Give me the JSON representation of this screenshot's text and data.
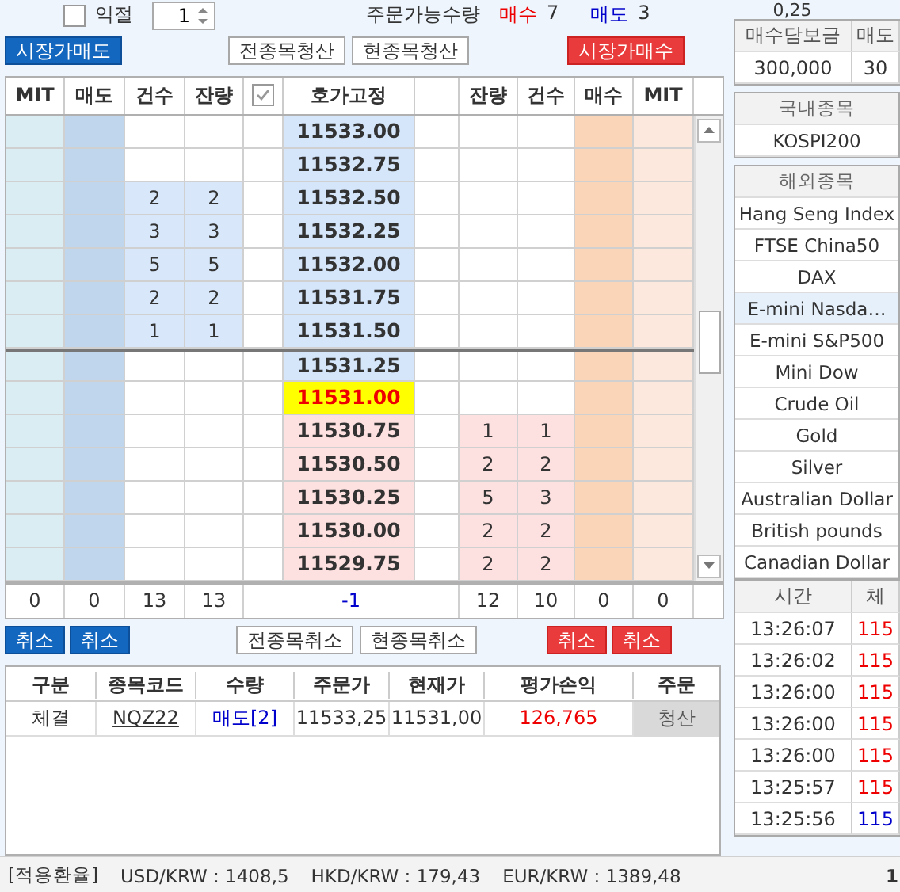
{
  "toolbar": {
    "take_profit": {
      "label": "익절",
      "checked": false
    },
    "quantity": "1",
    "available_label": "주문가능수량",
    "buy_label": "매수",
    "buy_qty": "7",
    "sell_label": "매도",
    "sell_qty": "3"
  },
  "action_buttons": [
    {
      "label": "시장가매도",
      "kind": "sell"
    },
    {
      "label": "전종목청산",
      "kind": "plain"
    },
    {
      "label": "현종목청산",
      "kind": "plain"
    },
    {
      "label": "시장가매수",
      "kind": "buy"
    }
  ],
  "ladder": {
    "columns": [
      {
        "kind": "text",
        "label": "MIT"
      },
      {
        "kind": "text",
        "label": "매도"
      },
      {
        "kind": "text",
        "label": "건수"
      },
      {
        "kind": "text",
        "label": "잔량"
      },
      {
        "kind": "checkbox",
        "checked": true
      },
      {
        "kind": "text",
        "label": "호가고정"
      },
      {
        "kind": "blank"
      },
      {
        "kind": "text",
        "label": "잔량"
      },
      {
        "kind": "text",
        "label": "건수"
      },
      {
        "kind": "text",
        "label": "매수"
      },
      {
        "kind": "text",
        "label": "MIT"
      }
    ],
    "rows": [
      {
        "price": "11533.00",
        "kind": "ask",
        "boundary": false
      },
      {
        "price": "11532.75",
        "kind": "ask",
        "boundary": false
      },
      {
        "price": "11532.50",
        "kind": "ask",
        "ask_count": "2",
        "ask_qty": "2",
        "boundary": false
      },
      {
        "price": "11532.25",
        "kind": "ask",
        "ask_count": "3",
        "ask_qty": "3",
        "boundary": false
      },
      {
        "price": "11532.00",
        "kind": "ask",
        "ask_count": "5",
        "ask_qty": "5",
        "boundary": false
      },
      {
        "price": "11531.75",
        "kind": "ask",
        "ask_count": "2",
        "ask_qty": "2",
        "boundary": false
      },
      {
        "price": "11531.50",
        "kind": "ask",
        "ask_count": "1",
        "ask_qty": "1",
        "boundary": false
      },
      {
        "price": "11531.25",
        "kind": "ask",
        "boundary": true
      },
      {
        "price": "11531.00",
        "kind": "current",
        "boundary": false
      },
      {
        "price": "11530.75",
        "kind": "bid",
        "bid_qty": "1",
        "bid_count": "1",
        "boundary": false
      },
      {
        "price": "11530.50",
        "kind": "bid",
        "bid_qty": "2",
        "bid_count": "2",
        "boundary": false
      },
      {
        "price": "11530.25",
        "kind": "bid",
        "bid_qty": "5",
        "bid_count": "3",
        "boundary": false
      },
      {
        "price": "11530.00",
        "kind": "bid",
        "bid_qty": "2",
        "bid_count": "2",
        "boundary": false
      },
      {
        "price": "11529.75",
        "kind": "bid",
        "bid_qty": "2",
        "bid_count": "2",
        "boundary": false
      }
    ],
    "totals": {
      "mit_sell": "0",
      "sell": "0",
      "ask_count": "13",
      "ask_qty": "13",
      "net": "-1",
      "bid_qty": "12",
      "bid_count": "10",
      "buy": "0",
      "mit_buy": "0"
    }
  },
  "cancel_buttons": [
    {
      "label": "취소",
      "kind": "sell"
    },
    {
      "label": "취소",
      "kind": "sell"
    },
    {
      "label": "전종목취소",
      "kind": "plain"
    },
    {
      "label": "현종목취소",
      "kind": "plain"
    },
    {
      "label": "취소",
      "kind": "buy"
    },
    {
      "label": "취소",
      "kind": "buy"
    }
  ],
  "positions": {
    "columns": [
      "구분",
      "종목코드",
      "수량",
      "주문가",
      "현재가",
      "평가손익",
      "주문"
    ],
    "rows": [
      {
        "type": "체결",
        "code": "NQZ22",
        "quantity": "매도[2]",
        "short": true,
        "order_price": "11533,25",
        "current_price": "11531,00",
        "pnl": "126,765",
        "profit": true,
        "action": "청산"
      }
    ]
  },
  "side_panel": {
    "tick_size": "0,25",
    "margin": {
      "columns": [
        "매수담보금",
        "매도"
      ],
      "values": [
        "300,000",
        "30"
      ]
    },
    "domestic": {
      "title": "국내종목",
      "items": [
        {
          "label": "KOSPI200",
          "selected": false
        }
      ]
    },
    "overseas": {
      "title": "해외종목",
      "items": [
        {
          "label": "Hang Seng Index",
          "selected": false
        },
        {
          "label": "FTSE China50",
          "selected": false
        },
        {
          "label": "DAX",
          "selected": false
        },
        {
          "label": "E-mini Nasda…",
          "selected": true
        },
        {
          "label": "E-mini S&P500",
          "selected": false
        },
        {
          "label": "Mini Dow",
          "selected": false
        },
        {
          "label": "Crude Oil",
          "selected": false
        },
        {
          "label": "Gold",
          "selected": false
        },
        {
          "label": "Silver",
          "selected": false
        },
        {
          "label": "Australian Dollar",
          "selected": false
        },
        {
          "label": "British pounds",
          "selected": false
        },
        {
          "label": "Canadian Dollar",
          "selected": false
        }
      ]
    },
    "trades": {
      "columns": [
        "시간",
        "체"
      ],
      "rows": [
        {
          "time": "13:26:07",
          "price": "115",
          "rising": true
        },
        {
          "time": "13:26:02",
          "price": "115",
          "rising": true
        },
        {
          "time": "13:26:00",
          "price": "115",
          "rising": true
        },
        {
          "time": "13:26:00",
          "price": "115",
          "rising": true
        },
        {
          "time": "13:26:00",
          "price": "115",
          "rising": true
        },
        {
          "time": "13:25:57",
          "price": "115",
          "rising": true
        },
        {
          "time": "13:25:56",
          "price": "115",
          "rising": false
        }
      ]
    }
  },
  "status_bar": {
    "label": "[적용환율]",
    "rates": [
      "USD/KRW : 1408,5",
      "HKD/KRW : 179,43",
      "EUR/KRW : 1389,48"
    ],
    "page": "1"
  }
}
